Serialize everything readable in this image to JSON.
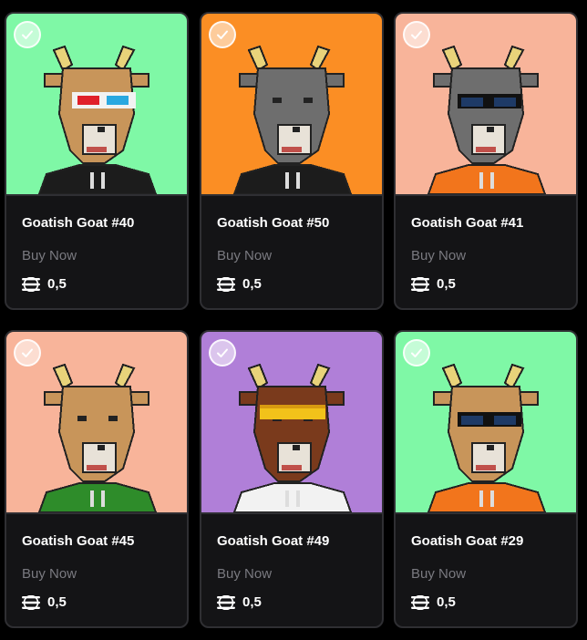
{
  "cards": [
    {
      "title": "Goatish Goat #40",
      "status": "Buy Now",
      "price": "0,5",
      "bg": "#7ff8a6",
      "fur": "#c8955a",
      "acc": "3d-glasses",
      "top": "#1c1c1c"
    },
    {
      "title": "Goatish Goat #50",
      "status": "Buy Now",
      "price": "0,5",
      "bg": "#fb8e24",
      "fur": "#6e6e6e",
      "acc": "none",
      "top": "#1c1c1c"
    },
    {
      "title": "Goatish Goat #41",
      "status": "Buy Now",
      "price": "0,5",
      "bg": "#f8b49a",
      "fur": "#6e6e6e",
      "acc": "sunglasses",
      "top": "#f2751c"
    },
    {
      "title": "Goatish Goat #45",
      "status": "Buy Now",
      "price": "0,5",
      "bg": "#f8b49a",
      "fur": "#c8955a",
      "acc": "none",
      "top": "#2e8c2a"
    },
    {
      "title": "Goatish Goat #49",
      "status": "Buy Now",
      "price": "0,5",
      "bg": "#b07fd8",
      "fur": "#7a3a1c",
      "acc": "visor",
      "top": "#f2f2f2"
    },
    {
      "title": "Goatish Goat #29",
      "status": "Buy Now",
      "price": "0,5",
      "bg": "#7ff8a6",
      "fur": "#c8955a",
      "acc": "sunglasses",
      "top": "#f2751c"
    }
  ],
  "icons": {
    "select": "checkmark-circle-icon",
    "currency": "solana-icon"
  }
}
